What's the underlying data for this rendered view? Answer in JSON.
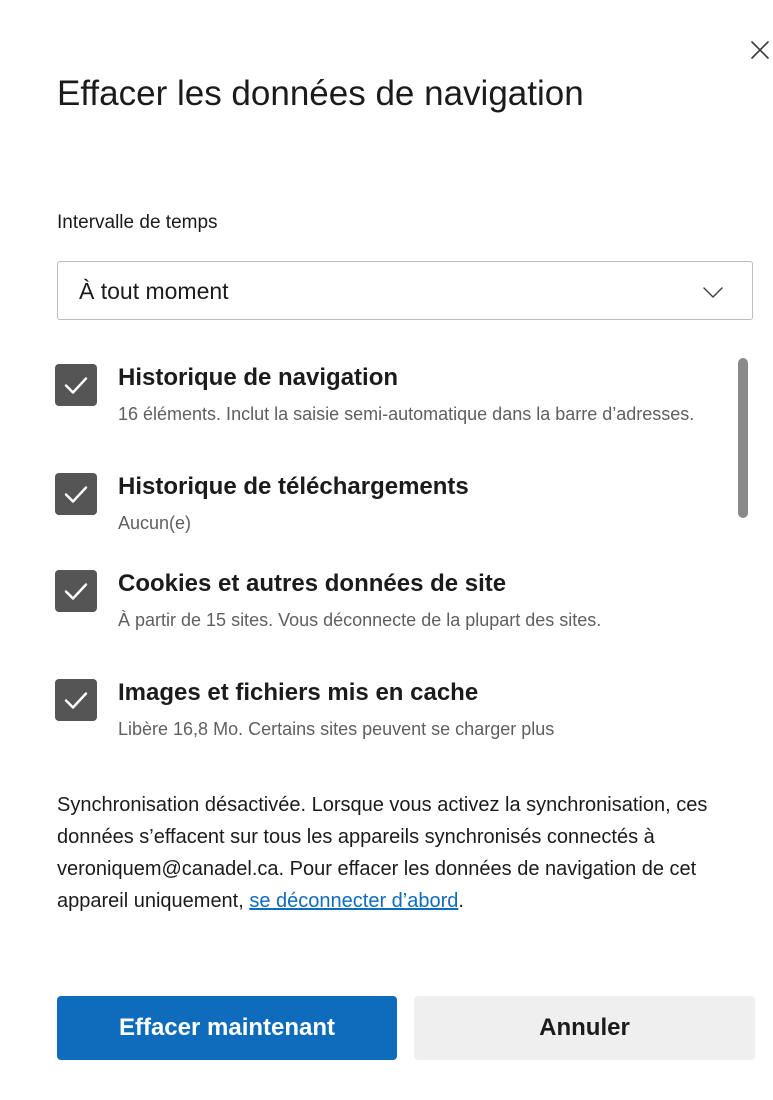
{
  "dialog": {
    "title": "Effacer les données de navigation",
    "close_icon": "close-icon"
  },
  "time_range": {
    "label": "Intervalle de temps",
    "selected": "À tout moment",
    "chevron_icon": "chevron-down-icon"
  },
  "items": [
    {
      "title": "Historique de navigation",
      "description": "16 éléments. Inclut la saisie semi-automatique dans la barre d’adresses.",
      "checked": true
    },
    {
      "title": "Historique de téléchargements",
      "description": "Aucun(e)",
      "checked": true
    },
    {
      "title": "Cookies et autres données de site",
      "description": "À partir de 15 sites. Vous déconnecte de la plupart des sites.",
      "checked": true
    },
    {
      "title": "Images et fichiers mis en cache",
      "description": "Libère 16,8 Mo. Certains sites peuvent se charger plus",
      "checked": true
    }
  ],
  "sync_notice": {
    "text": "Synchronisation désactivée. Lorsque vous activez la synchronisation, ces données s’effacent sur tous les appareils synchronisés connectés à veroniquem@canadel.ca. Pour effacer les données de navigation de cet appareil uniquement, ",
    "link_text": "se déconnecter d’abord",
    "suffix": "."
  },
  "buttons": {
    "primary_label": "Effacer maintenant",
    "secondary_label": "Annuler"
  },
  "colors": {
    "accent": "#0f6cbd",
    "checkbox": "#555555",
    "secondary_button": "#efefef"
  }
}
